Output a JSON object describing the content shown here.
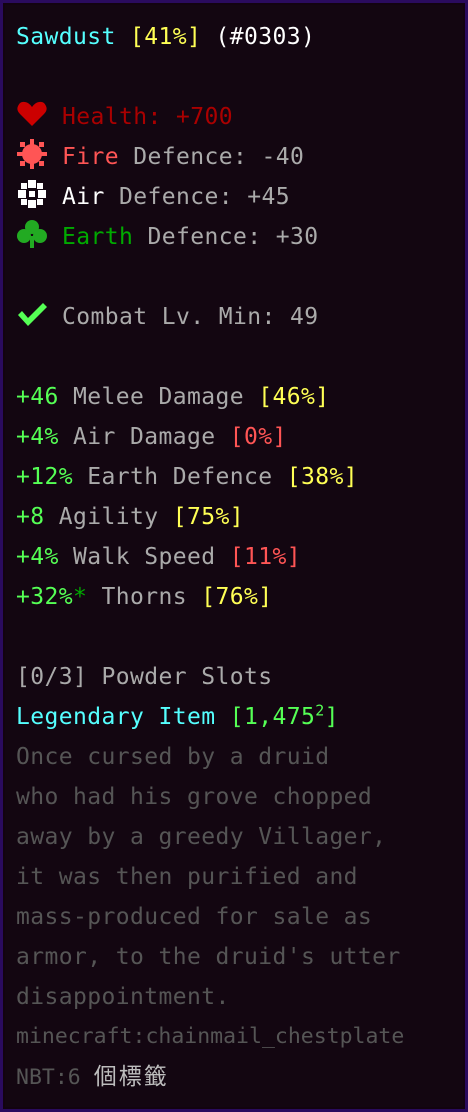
{
  "title": {
    "name": "Sawdust",
    "roll": "[41%]",
    "id": "(#0303)"
  },
  "base_stats": [
    {
      "icon": "heart-icon",
      "label": "Health:",
      "value": "+700",
      "label_color": "#aa0000"
    },
    {
      "icon": "fire-icon",
      "element": "Fire",
      "label": "Defence:",
      "value": "-40",
      "element_color": "#ff5555"
    },
    {
      "icon": "air-icon",
      "element": "Air",
      "label": "Defence:",
      "value": "+45",
      "element_color": "#ffffff"
    },
    {
      "icon": "earth-icon",
      "element": "Earth",
      "label": "Defence:",
      "value": "+30",
      "element_color": "#00aa00"
    }
  ],
  "requirement": {
    "icon": "checkmark-icon",
    "label": "Combat Lv. Min:",
    "value": "49"
  },
  "identifications": [
    {
      "value": "+46",
      "name": "Melee Damage",
      "roll": "[46%]",
      "roll_color": "#ffff55"
    },
    {
      "value": "+4%",
      "name": "Air Damage",
      "roll": "[0%]",
      "roll_color": "#ff5555"
    },
    {
      "value": "+12%",
      "name": "Earth Defence",
      "roll": "[38%]",
      "roll_color": "#ffff55"
    },
    {
      "value": "+8",
      "name": "Agility",
      "roll": "[75%]",
      "roll_color": "#ffff55"
    },
    {
      "value": "+4%",
      "name": "Walk Speed",
      "roll": "[11%]",
      "roll_color": "#ff5555"
    },
    {
      "value": "+32%",
      "star": "*",
      "name": "Thorns",
      "roll": "[76%]",
      "roll_color": "#ffff55"
    }
  ],
  "powder_slots": "[0/3] Powder Slots",
  "rarity": {
    "label": "Legendary Item",
    "rerolls_open": "[1,475",
    "rerolls_sup": "2",
    "rerolls_close": "]"
  },
  "lore": [
    "Once cursed by a druid",
    "who had his grove chopped",
    "away by a greedy Villager,",
    "it was then purified and",
    "mass-produced for sale as",
    "armor, to the druid's utter",
    "disappointment."
  ],
  "item_id": "minecraft:chainmail_chestplate",
  "nbt": {
    "label": "NBT:6",
    "tags": "個標籤"
  },
  "colors": {
    "background": "#130611",
    "border": "#2a0b5e",
    "aqua": "#55ffff",
    "yellow": "#ffff55",
    "green": "#55ff55",
    "gray": "#aaaaaa",
    "dark_gray": "#555555"
  }
}
